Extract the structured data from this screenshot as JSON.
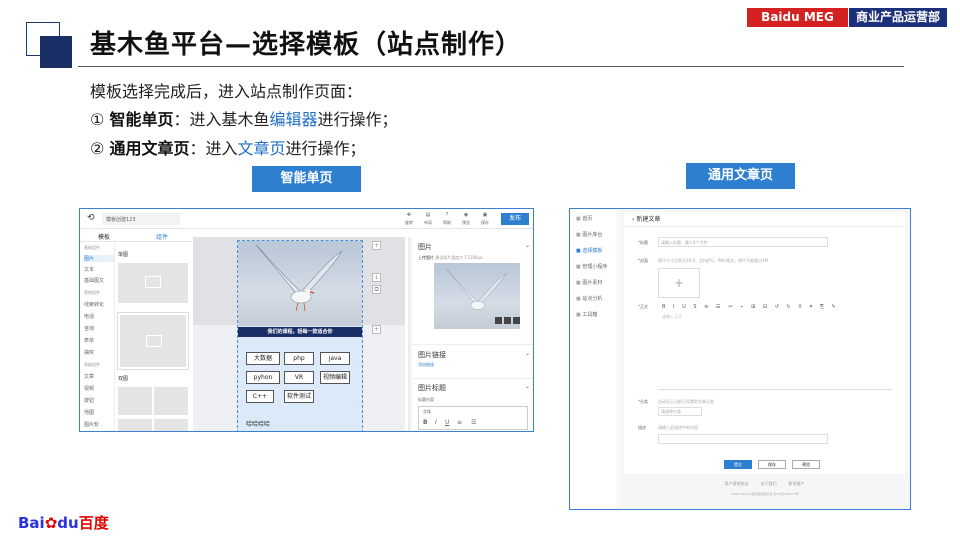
{
  "header": {
    "title": "基木鱼平台—选择模板（站点制作）",
    "badge_left": "Baidu MEG",
    "badge_right": "商业产品运营部"
  },
  "intro": "模板选择完成后，进入站点制作页面：",
  "item1": {
    "num": "①",
    "bold": "智能单页",
    "pre": "：进入基木鱼",
    "link": "编辑器",
    "post": "进行操作；"
  },
  "item2": {
    "num": "②",
    "bold": "通用文章页",
    "pre": "：进入",
    "link": "文章页",
    "post": "进行操作；"
  },
  "label_left": "智能单页",
  "label_right": "通用文章页",
  "editor": {
    "doc_title": "模板创建123",
    "toolbar": [
      "旋转",
      "布局",
      "帮助",
      "预览",
      "保存"
    ],
    "publish": "发布",
    "tabs": [
      "模板",
      "组件"
    ],
    "groups": [
      {
        "name": "基础组件",
        "items": [
          "图片",
          "文本",
          "基础图文"
        ]
      },
      {
        "name": "营销组件",
        "items": [
          "线索转化",
          "电话",
          "咨询",
          "表单",
          "抽奖"
        ]
      },
      {
        "name": "高级组件",
        "items": [
          "文章",
          "视频",
          "按钮",
          "地图",
          "图片轮"
        ]
      }
    ],
    "thumb_headers": [
      "单图",
      "双图"
    ],
    "canvas_banner": "我们的课程，轻每一款适合你",
    "course_tags": [
      "大数据",
      "php",
      "java",
      "pyhon",
      "VR",
      "视频编辑",
      "C++",
      "软件测试"
    ],
    "canvas_footer": "哈哈哈哈",
    "panel": {
      "image_title": "图片",
      "upload": "上传图片",
      "upload_hint": "建议图片宽度大于1280px",
      "image_link": "图片链接",
      "add_link": "添加链接",
      "image_caption": "图片标题",
      "caption_content": "标题内容",
      "font_label": "字体"
    }
  },
  "article": {
    "sidebar": [
      "首页",
      "图片库台",
      "选择模板",
      "管理小程序",
      "图片素材",
      "站点分析",
      "工具箱"
    ],
    "active_index": 2,
    "page_title": "新建文章",
    "fields": {
      "title_label": "*标题",
      "title_placeholder": "请输入标题，最少4个字符",
      "cover_label": "*封面",
      "cover_hint": "图片尺寸比例为16:9，支持JPG、PNG格式，图片不能超过4M",
      "body_label": "*正文",
      "body_placeholder": "请输入正文",
      "category_label": "*分类",
      "category_hint": "自动显示当前已设置的文章分类",
      "category_select": "请选择分类",
      "desc_label": "描述",
      "desc_placeholder": "请输入此描述中的内容"
    },
    "buttons": [
      "提交",
      "保存",
      "预览"
    ],
    "footer1": "用户营销协议　　　关于我们　　　联系客户",
    "footer2": "©2024 Baidu 使用百度前必读 京ICP证030173号"
  },
  "brand": {
    "logo_blue": "Bai",
    "logo_red": "du",
    "logo_cn": "百度"
  },
  "colors": {
    "accent": "#2e7fd0",
    "red_badge": "#d42121",
    "navy_badge": "#1b2f7a",
    "link": "#1f6fc9"
  }
}
